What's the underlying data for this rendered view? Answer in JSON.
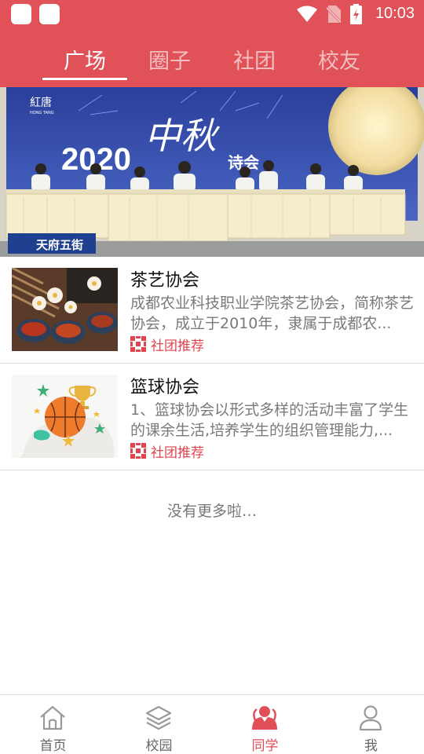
{
  "status_bar": {
    "time": "10:03",
    "icons": [
      "app-square-icon",
      "app-square-icon",
      "wifi-icon",
      "no-sim-icon",
      "battery-charging-icon"
    ]
  },
  "tabs": [
    {
      "label": "广场",
      "active": true
    },
    {
      "label": "圈子",
      "active": false
    },
    {
      "label": "社团",
      "active": false
    },
    {
      "label": "校友",
      "active": false
    }
  ],
  "banner": {
    "year": "2020",
    "title_glyph": "中秋",
    "title_suffix": "诗会",
    "logo_text": "紅唐",
    "logo_sub": "HONG TANG",
    "caption": "天府五街"
  },
  "clubs": [
    {
      "title": "茶艺协会",
      "desc": "成都农业科技职业学院茶艺协会，简称茶艺协会，成立于2010年，隶属于成都农...",
      "tag": "社团推荐",
      "thumb_icon": "tea-set-image"
    },
    {
      "title": "篮球协会",
      "desc": "1、篮球协会以形式多样的活动丰富了学生的课余生活,培养学生的组织管理能力,...",
      "tag": "社团推荐",
      "thumb_icon": "basketball-image"
    }
  ],
  "list_footer": "没有更多啦…",
  "bottom_nav": [
    {
      "label": "首页",
      "icon": "home-icon",
      "active": false
    },
    {
      "label": "校园",
      "icon": "layers-icon",
      "active": false
    },
    {
      "label": "同学",
      "icon": "classmates-icon",
      "active": true
    },
    {
      "label": "我",
      "icon": "person-icon",
      "active": false
    }
  ],
  "colors": {
    "brand": "#e05258",
    "tag": "#e2434e",
    "nav_active": "#e04f58"
  }
}
